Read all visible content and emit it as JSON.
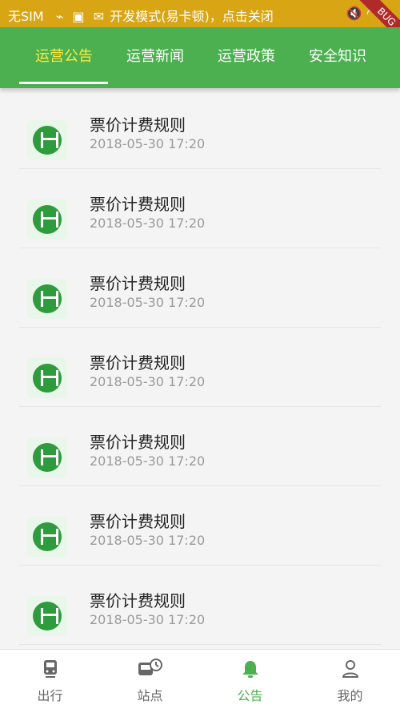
{
  "status_bar": {
    "left_text": "无SIM",
    "center_text": "开发模式(易卡顿)，点击关闭",
    "debug": "BUG"
  },
  "tabs": [
    {
      "label": "运营公告",
      "active": true
    },
    {
      "label": "运营新闻",
      "active": false
    },
    {
      "label": "运营政策",
      "active": false
    },
    {
      "label": "安全知识",
      "active": false
    }
  ],
  "list": [
    {
      "title": "票价计费规则",
      "time": "2018-05-30 17:20"
    },
    {
      "title": "票价计费规则",
      "time": "2018-05-30 17:20"
    },
    {
      "title": "票价计费规则",
      "time": "2018-05-30 17:20"
    },
    {
      "title": "票价计费规则",
      "time": "2018-05-30 17:20"
    },
    {
      "title": "票价计费规则",
      "time": "2018-05-30 17:20"
    },
    {
      "title": "票价计费规则",
      "time": "2018-05-30 17:20"
    },
    {
      "title": "票价计费规则",
      "time": "2018-05-30 17:20"
    }
  ],
  "bottom_nav": [
    {
      "label": "出行",
      "icon": "metro-icon",
      "active": false
    },
    {
      "label": "站点",
      "icon": "bus-clock-icon",
      "active": false
    },
    {
      "label": "公告",
      "icon": "bell-icon",
      "active": true
    },
    {
      "label": "我的",
      "icon": "user-icon",
      "active": false
    }
  ],
  "colors": {
    "accent": "#4caf50",
    "active_tab": "#ffeb3b",
    "status_bar": "#d8a515"
  }
}
